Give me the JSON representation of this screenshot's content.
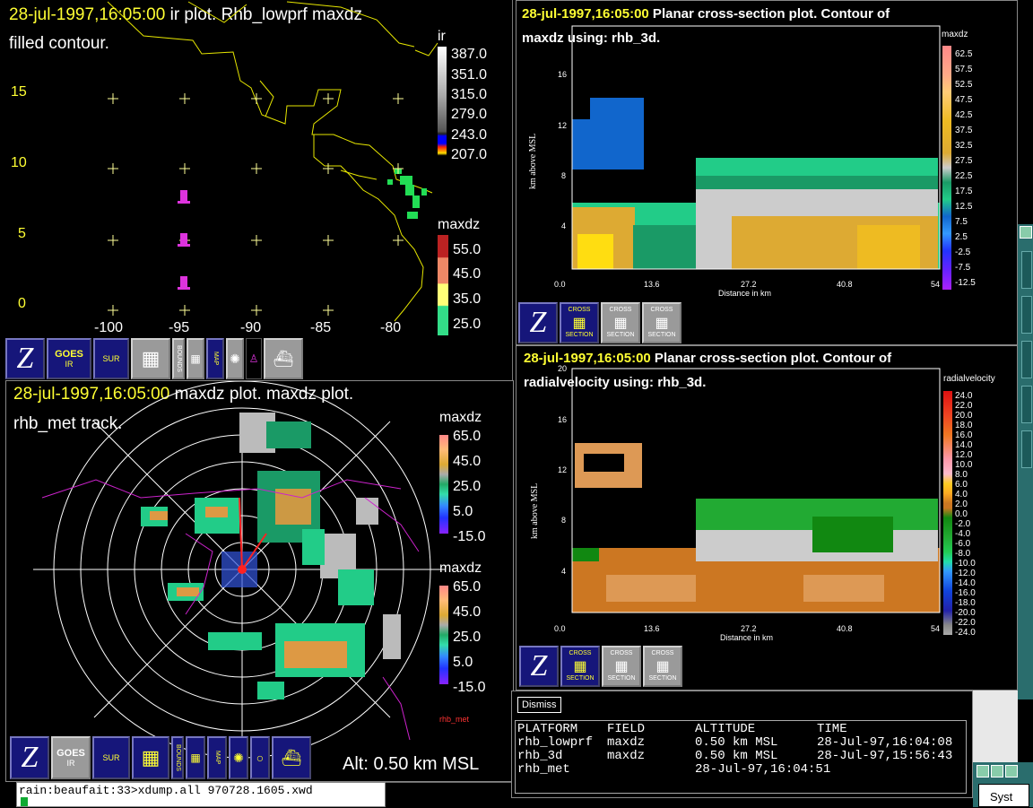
{
  "ir_window": {
    "title_time": "28-jul-1997,16:05:00",
    "title_rest": " ir plot.  Rhb_lowprf maxdz",
    "subtitle": "filled contour.",
    "ir_legend_label": "ir",
    "ir_legend_values": [
      "387.0",
      "351.0",
      "315.0",
      "279.0",
      "243.0",
      "207.0"
    ],
    "maxdz_legend_label": "maxdz",
    "maxdz_legend_values": [
      "55.0",
      "45.0",
      "35.0",
      "25.0"
    ],
    "y_ticks": [
      "15",
      "10",
      "5",
      "0"
    ],
    "x_ticks": [
      "-100",
      "-95",
      "-90",
      "-85",
      "-80"
    ]
  },
  "radar_window": {
    "title_time": "28-jul-1997,16:05:00",
    "title_rest": " maxdz plot.  maxdz plot.",
    "subtitle": "rhb_met track.",
    "legend1_label": "maxdz",
    "legend1_values": [
      "65.0",
      "45.0",
      "25.0",
      "5.0",
      "-15.0"
    ],
    "legend2_label": "maxdz",
    "legend2_values": [
      "65.0",
      "45.0",
      "25.0",
      "5.0",
      "-15.0"
    ],
    "track_label": "rhb_met",
    "altitude": "Alt: 0.50 km MSL"
  },
  "cross1_window": {
    "title_time": "28-jul-1997,16:05:00",
    "title_rest": " Planar cross-section plot.  Contour of",
    "subtitle": "maxdz using: rhb_3d.",
    "legend_label": "maxdz",
    "legend_values": [
      "62.5",
      "57.5",
      "52.5",
      "47.5",
      "42.5",
      "37.5",
      "32.5",
      "27.5",
      "22.5",
      "17.5",
      "12.5",
      "7.5",
      "2.5",
      "-2.5",
      "-7.5",
      "-12.5"
    ],
    "ylabel": "km above MSL",
    "xlabel": "Distance in km",
    "y_ticks": [
      "16",
      "12",
      "8",
      "4"
    ],
    "x_ticks": [
      "0.0",
      "13.6",
      "27.2",
      "40.8",
      "54"
    ]
  },
  "cross2_window": {
    "title_time": "28-jul-1997,16:05:00",
    "title_rest": " Planar cross-section plot.  Contour of",
    "subtitle": "radialvelocity using: rhb_3d.",
    "legend_label": "radialvelocity",
    "legend_values": [
      "24.0",
      "22.0",
      "20.0",
      "18.0",
      "16.0",
      "14.0",
      "12.0",
      "10.0",
      "8.0",
      "6.0",
      "4.0",
      "2.0",
      "0.0",
      "-2.0",
      "-4.0",
      "-6.0",
      "-8.0",
      "-10.0",
      "-12.0",
      "-14.0",
      "-16.0",
      "-18.0",
      "-20.0",
      "-22.0",
      "-24.0"
    ],
    "ylabel": "km above MSL",
    "xlabel": "Distance in km",
    "y_top": "20",
    "y_ticks": [
      "16",
      "12",
      "8",
      "4"
    ],
    "x_ticks": [
      "0.0",
      "13.6",
      "27.2",
      "40.8",
      "54"
    ]
  },
  "toolbar": {
    "goes": "GOES",
    "ir": "IR",
    "sur": "SUR",
    "bounds": "BOUNDS",
    "map": "MAP",
    "cross": "CROSS",
    "section": "SECTION"
  },
  "info_panel": {
    "dismiss": "Dismiss",
    "headers": [
      "PLATFORM",
      "FIELD",
      "ALTITUDE",
      "TIME"
    ],
    "rows": [
      [
        "rhb_lowprf",
        "maxdz",
        "0.50 km MSL",
        "28-Jul-97,16:04:08"
      ],
      [
        "rhb_3d",
        "maxdz",
        "0.50 km MSL",
        "28-Jul-97,15:56:43"
      ],
      [
        "rhb_met",
        "",
        "28-Jul-97,16:04:51",
        ""
      ]
    ]
  },
  "terminal": {
    "prompt": "rain:beaufait:33>xdump.all 970728.1605.xwd"
  },
  "side": {
    "syst_label": "Syst"
  },
  "colors": {
    "title_yellow": "#ffff33",
    "toolbar_blue": "#16167a",
    "coast_yellow": "#e6e600",
    "track_magenta": "#cc22cc"
  }
}
